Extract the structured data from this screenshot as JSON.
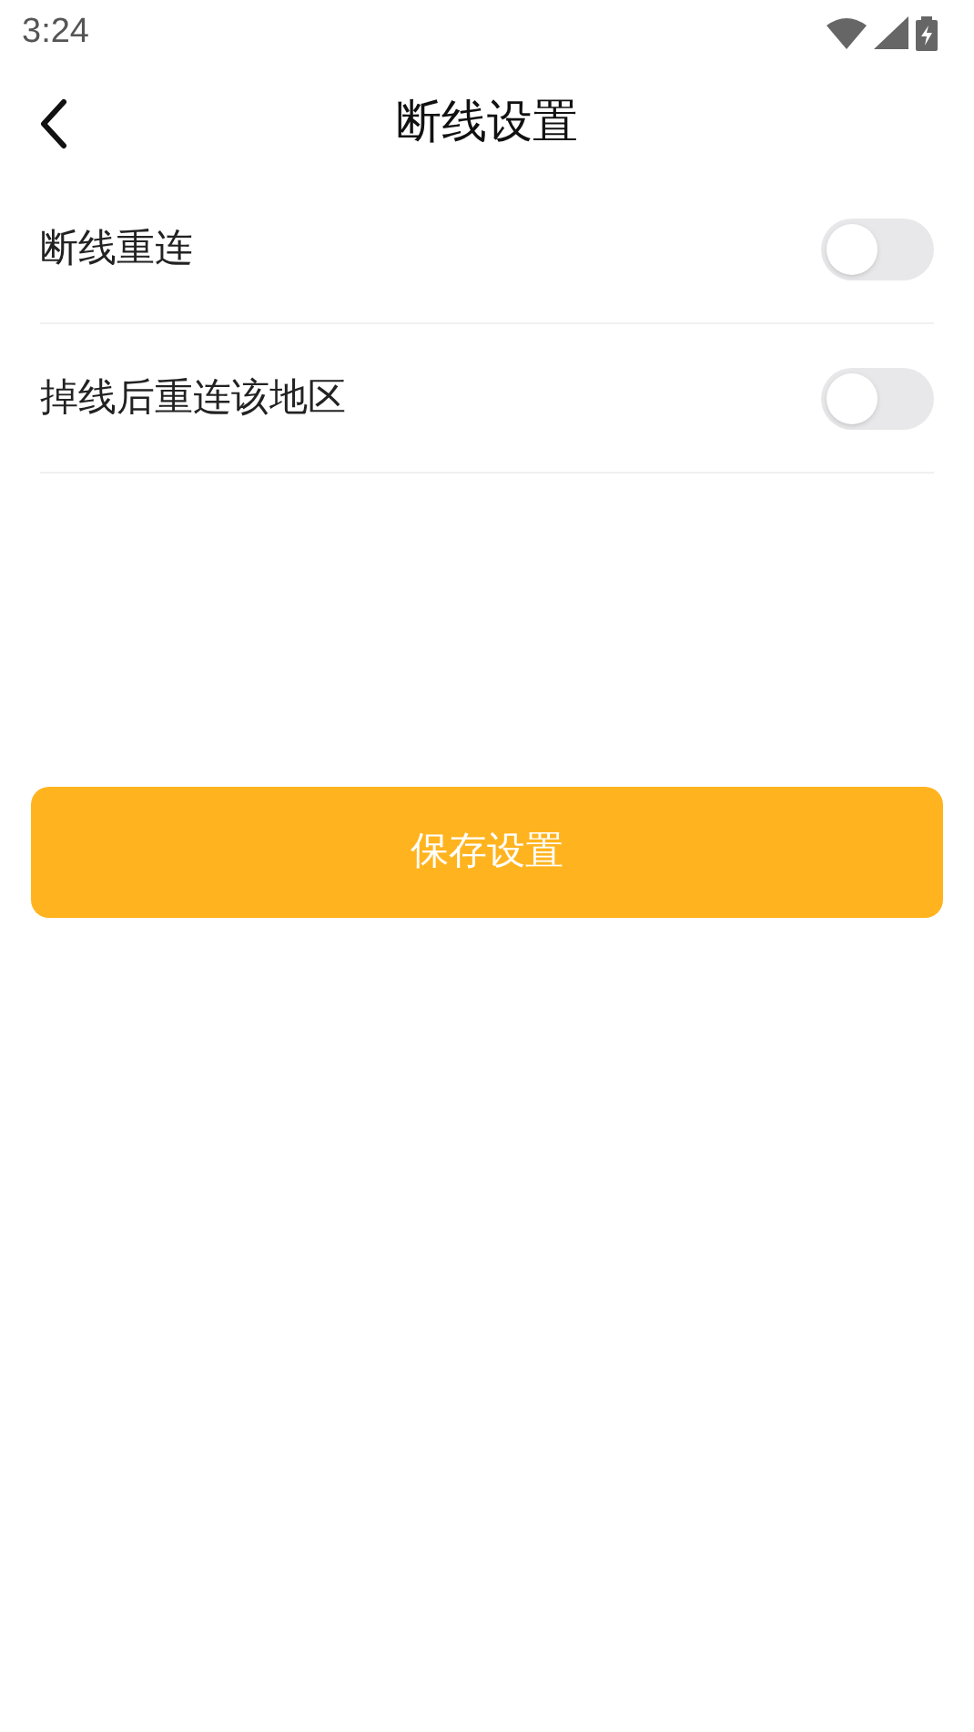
{
  "status_bar": {
    "time": "3:24"
  },
  "header": {
    "title": "断线设置"
  },
  "settings": [
    {
      "label": "断线重连",
      "on": false
    },
    {
      "label": "掉线后重连该地区",
      "on": false
    }
  ],
  "save_button": {
    "label": "保存设置"
  }
}
